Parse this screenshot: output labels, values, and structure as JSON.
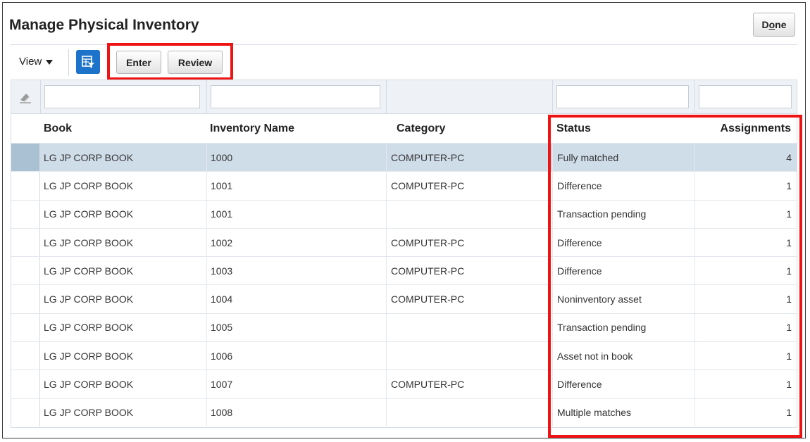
{
  "page": {
    "title": "Manage Physical Inventory",
    "done_label_pre": "D",
    "done_label_u": "o",
    "done_label_post": "ne"
  },
  "toolbar": {
    "view_label": "View",
    "enter_label": "Enter",
    "review_label": "Review"
  },
  "colors": {
    "highlight": "#ef1414",
    "selected_row": "#cfdde9",
    "filter_button": "#1d73c9"
  },
  "table": {
    "headers": {
      "book": "Book",
      "inventory_name": "Inventory Name",
      "category": "Category",
      "status": "Status",
      "assignments": "Assignments"
    },
    "rows": [
      {
        "book": "LG JP CORP BOOK",
        "inventory_name": "1000",
        "category": "COMPUTER-PC",
        "status": "Fully matched",
        "assignments": "4"
      },
      {
        "book": "LG JP CORP BOOK",
        "inventory_name": "1001",
        "category": "COMPUTER-PC",
        "status": "Difference",
        "assignments": "1"
      },
      {
        "book": "LG JP CORP BOOK",
        "inventory_name": "1001",
        "category": "",
        "status": "Transaction pending",
        "assignments": "1"
      },
      {
        "book": "LG JP CORP BOOK",
        "inventory_name": "1002",
        "category": "COMPUTER-PC",
        "status": "Difference",
        "assignments": "1"
      },
      {
        "book": "LG JP CORP BOOK",
        "inventory_name": "1003",
        "category": "COMPUTER-PC",
        "status": "Difference",
        "assignments": "1"
      },
      {
        "book": "LG JP CORP BOOK",
        "inventory_name": "1004",
        "category": "COMPUTER-PC",
        "status": "Noninventory asset",
        "assignments": "1"
      },
      {
        "book": "LG JP CORP BOOK",
        "inventory_name": "1005",
        "category": "",
        "status": "Transaction pending",
        "assignments": "1"
      },
      {
        "book": "LG JP CORP BOOK",
        "inventory_name": "1006",
        "category": "",
        "status": "Asset not in book",
        "assignments": "1"
      },
      {
        "book": "LG JP CORP BOOK",
        "inventory_name": "1007",
        "category": "COMPUTER-PC",
        "status": "Difference",
        "assignments": "1"
      },
      {
        "book": "LG JP CORP BOOK",
        "inventory_name": "1008",
        "category": "",
        "status": "Multiple matches",
        "assignments": "1"
      }
    ]
  }
}
